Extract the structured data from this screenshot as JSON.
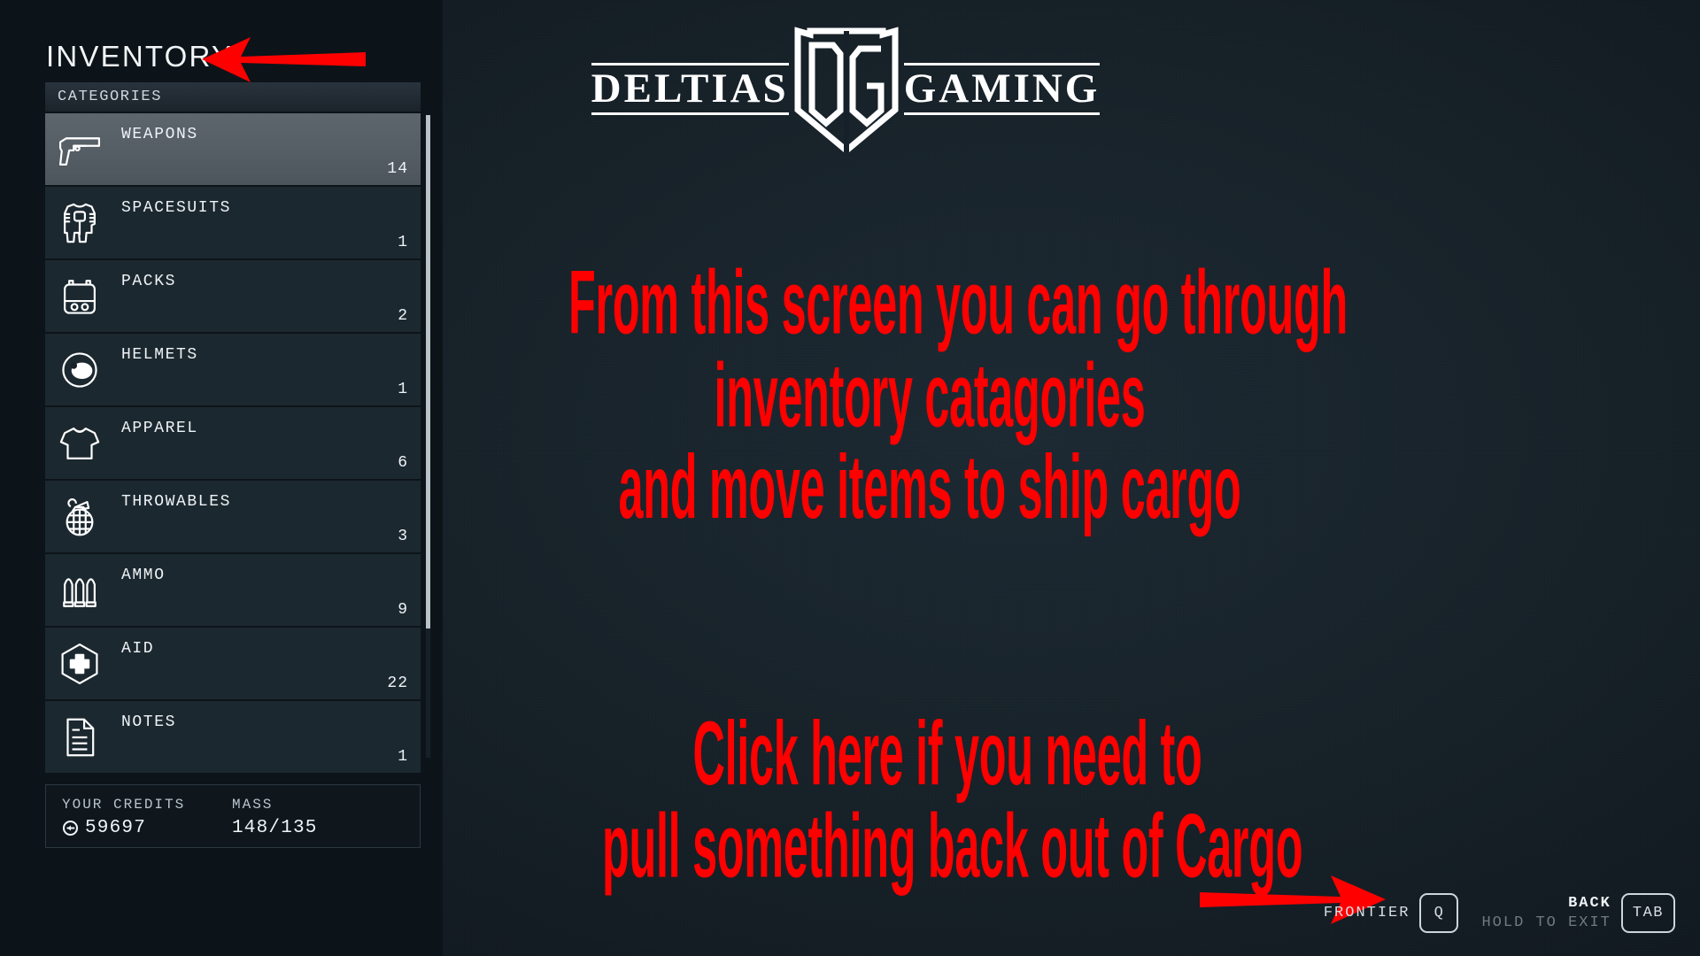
{
  "page_title": "INVENTORY",
  "brand": {
    "left_word": "DELTIAS",
    "right_word": "GAMING",
    "monogram": "DG"
  },
  "sidebar": {
    "header_label": "CATEGORIES",
    "items": [
      {
        "label": "WEAPONS",
        "count": "14",
        "icon": "pistol-icon",
        "selected": true
      },
      {
        "label": "SPACESUITS",
        "count": "1",
        "icon": "spacesuit-icon",
        "selected": false
      },
      {
        "label": "PACKS",
        "count": "2",
        "icon": "backpack-icon",
        "selected": false
      },
      {
        "label": "HELMETS",
        "count": "1",
        "icon": "helmet-icon",
        "selected": false
      },
      {
        "label": "APPAREL",
        "count": "6",
        "icon": "tshirt-icon",
        "selected": false
      },
      {
        "label": "THROWABLES",
        "count": "3",
        "icon": "grenade-icon",
        "selected": false
      },
      {
        "label": "AMMO",
        "count": "9",
        "icon": "bullets-icon",
        "selected": false
      },
      {
        "label": "AID",
        "count": "22",
        "icon": "medkit-icon",
        "selected": false
      },
      {
        "label": "NOTES",
        "count": "1",
        "icon": "note-icon",
        "selected": false
      }
    ]
  },
  "footer_stats": {
    "credits_label": "YOUR CREDITS",
    "credits_value": "59697",
    "credits_icon": "credit-icon",
    "mass_label": "MASS",
    "mass_value": "148/135"
  },
  "annotations": {
    "block1": [
      "From this screen you can go through",
      "inventory catagories",
      "and move items to ship cargo"
    ],
    "block2": [
      "Click here if you need to",
      "pull something back out of Cargo"
    ],
    "arrow_color": "#fe0000",
    "text_color": "#fe0000"
  },
  "control_bar": {
    "frontier_label": "FRONTIER",
    "frontier_key": "Q",
    "back_label": "BACK",
    "exit_hint": "HOLD TO EXIT",
    "back_key": "TAB"
  },
  "colors": {
    "background": "#162027",
    "panel": "#0d1419",
    "row": "#1c2830",
    "row_selected": "#555d65",
    "accent_red": "#fe0000",
    "text": "#eef3f6"
  }
}
